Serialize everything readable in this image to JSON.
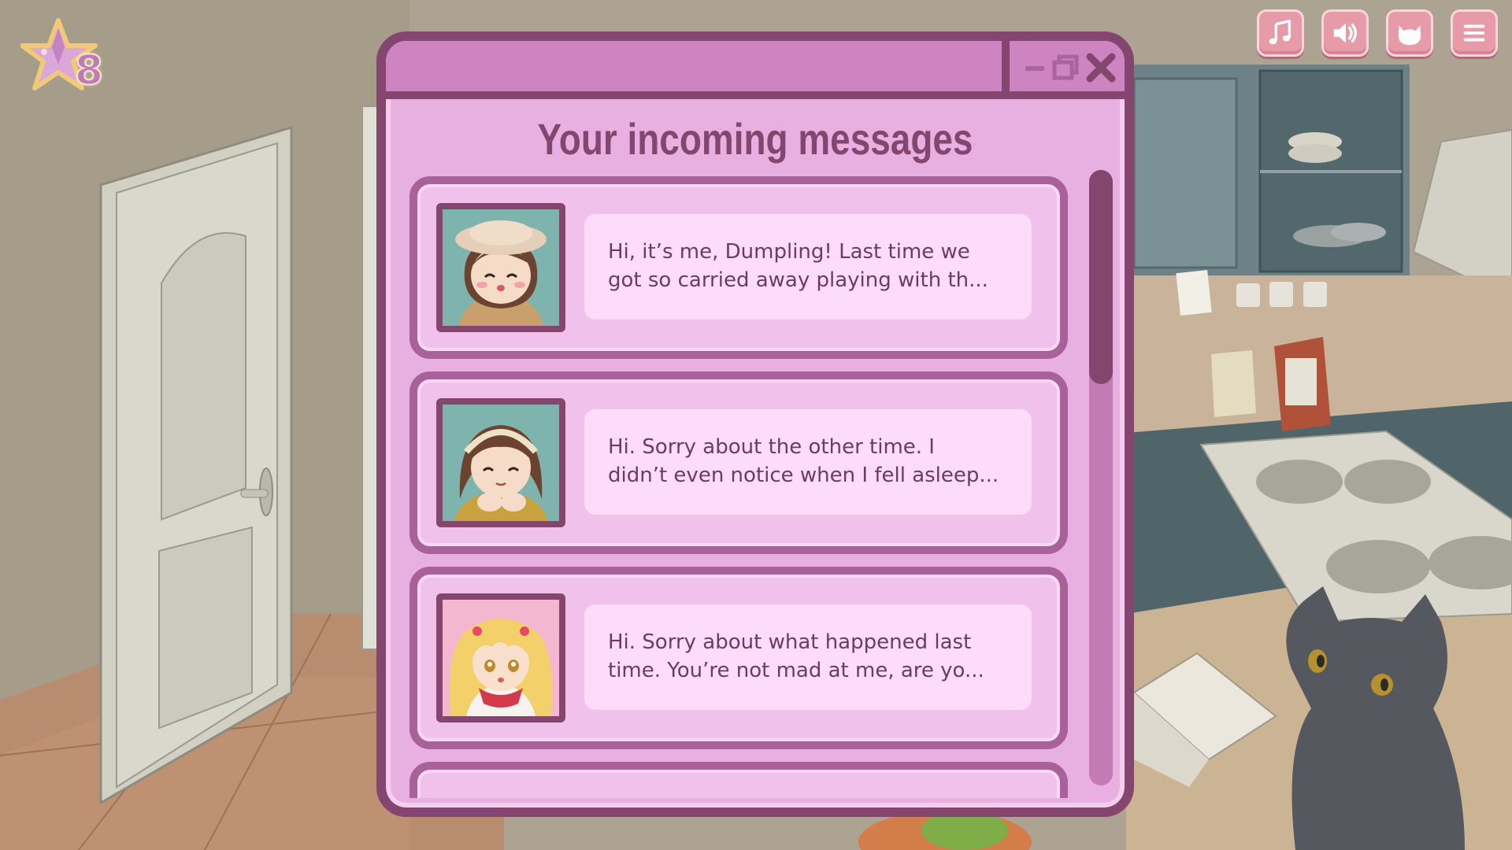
{
  "hud": {
    "star_count": "8",
    "buttons": [
      {
        "icon": "music-note-icon"
      },
      {
        "icon": "speaker-icon"
      },
      {
        "icon": "cat-head-icon"
      },
      {
        "icon": "hamburger-menu-icon"
      }
    ]
  },
  "window": {
    "title": "Your incoming messages",
    "controls": [
      "minimize-icon",
      "maximize-icon",
      "close-icon"
    ]
  },
  "messages": [
    {
      "sender_avatar": "dumpling-avatar",
      "line1": "Hi, it’s me, Dumpling! Last time we",
      "line2": "got so carried away playing with th..."
    },
    {
      "sender_avatar": "brown-hair-headband-girl-avatar",
      "line1": "Hi. Sorry about the other time. I",
      "line2": "didn’t even notice when I fell asleep..."
    },
    {
      "sender_avatar": "blonde-twintails-girl-avatar",
      "line1": "Hi. Sorry about what happened last",
      "line2": "time. You’re not mad at me, are yo..."
    }
  ],
  "colors": {
    "window_border": "#84466f",
    "window_bg": "#e7b0e0",
    "titlebar": "#cd84c0",
    "bubble": "#fcdcf8",
    "hud_button": "#e79ba8"
  }
}
